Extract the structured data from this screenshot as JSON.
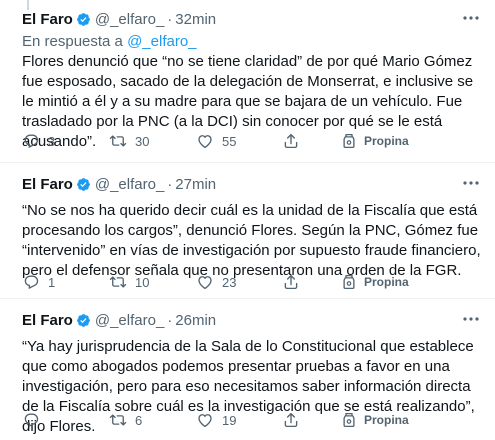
{
  "tweets": [
    {
      "name": "El Faro",
      "handle": "@_elfaro_",
      "separator": "·",
      "time": "32min",
      "reply_prefix": "En respuesta a",
      "reply_mention": "@_elfaro_",
      "text": "Flores denunció que “no se tiene claridad” de por qué Mario Gómez fue esposado, sacado de la delegación de Monserrat, e inclusive se le mintió a él y a su madre para que se bajara de un vehículo. Fue trasladado por la PNC (a la DCI) sin conocer por qué se le está acusando”.",
      "replies": "3",
      "retweets": "30",
      "likes": "55",
      "tip_label": "Propina"
    },
    {
      "name": "El Faro",
      "handle": "@_elfaro_",
      "separator": "·",
      "time": "27min",
      "text": "“No se nos ha querido decir cuál es la unidad de la Fiscalía que está procesando los cargos”, denunció Flores. Según la PNC, Gómez fue “intervenido” en vías de investigación por supuesto fraude financiero, pero el defensor señala que no presentaron una orden de la FGR.",
      "replies": "1",
      "retweets": "10",
      "likes": "23",
      "tip_label": "Propina"
    },
    {
      "name": "El Faro",
      "handle": "@_elfaro_",
      "separator": "·",
      "time": "26min",
      "text": "“Ya hay jurisprudencia de la Sala de lo Constitucional que establece que como abogados podemos presentar pruebas a favor en una investigación, pero para eso necesitamos saber información directa de la Fiscalía sobre cuál es la investigación que se está realizando”, dijo Flores.",
      "replies": "",
      "retweets": "6",
      "likes": "19",
      "tip_label": "Propina"
    }
  ],
  "colors": {
    "accent": "#1d9bf0",
    "secondary_text": "#536471",
    "primary_text": "#0f1419",
    "divider": "#eff3f4"
  },
  "icons": [
    "verified-badge-icon",
    "more-options-icon",
    "reply-icon",
    "retweet-icon",
    "like-icon",
    "share-icon",
    "tip-jar-icon"
  ]
}
